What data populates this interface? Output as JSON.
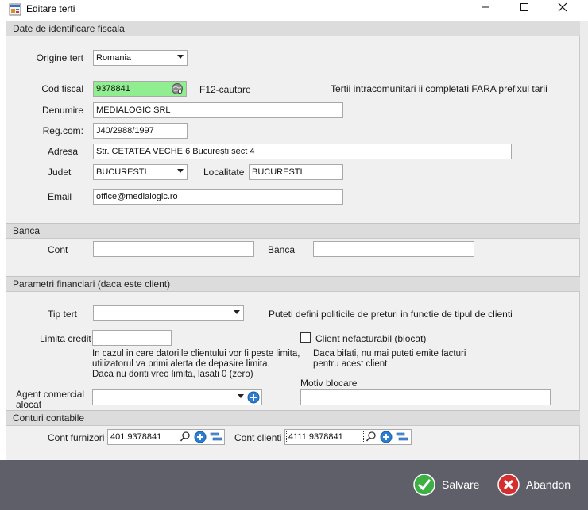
{
  "window": {
    "title": "Editare terti",
    "minimize_icon": "minimize-icon",
    "maximize_icon": "maximize-icon",
    "close_icon": "close-icon"
  },
  "sections": {
    "fiscal": "Date de identificare fiscala",
    "bank": "Banca",
    "financial": "Parametri financiari (daca este client)",
    "accounts": "Conturi contabile"
  },
  "fiscal": {
    "origin_label": "Origine tert",
    "origin_value": "Romania",
    "cod_fiscal_label": "Cod fiscal",
    "cod_fiscal_value": "9378841",
    "f12_hint": "F12-cautare",
    "intracom_note": "Tertii intracomunitari ii completati FARA prefixul tarii",
    "denumire_label": "Denumire",
    "denumire_value": "MEDIALOGIC SRL",
    "regcom_label": "Reg.com:",
    "regcom_value": "J40/2988/1997",
    "adresa_label": "Adresa",
    "adresa_value": "Str. CETATEA VECHE  6  București  sect 4",
    "judet_label": "Judet",
    "judet_value": "BUCURESTI",
    "localitate_label": "Localitate",
    "localitate_value": "BUCURESTI",
    "email_label": "Email",
    "email_value": "office@medialogic.ro"
  },
  "bank": {
    "cont_label": "Cont",
    "cont_value": "",
    "banca_label": "Banca",
    "banca_value": ""
  },
  "financial": {
    "tip_tert_label": "Tip tert",
    "tip_tert_value": "",
    "tip_tert_note": "Puteti defini politicile de preturi in functie de tipul de clienti",
    "limita_label": "Limita credit",
    "limita_value": "",
    "limita_help_1": "In cazul in care datoriile clientului vor fi peste limita,",
    "limita_help_2": "utilizatorul va primi alerta de depasire limita.",
    "limita_help_3": "Daca nu doriti vreo limita, lasati 0 (zero)",
    "nefacturabil_label": "Client nefacturabil (blocat)",
    "nefacturabil_checked": false,
    "nefacturabil_help_1": "Daca bifati, nu mai puteti emite facturi",
    "nefacturabil_help_2": "pentru acest client",
    "agent_label_1": "Agent comercial",
    "agent_label_2": "alocat",
    "agent_value": "",
    "motiv_label": "Motiv blocare",
    "motiv_value": ""
  },
  "accounts": {
    "furnizori_label": "Cont furnizori",
    "furnizori_value": "401.9378841",
    "clienti_label": "Cont clienti",
    "clienti_value": "4111.9378841"
  },
  "footer": {
    "save_label": "Salvare",
    "cancel_label": "Abandon"
  },
  "colors": {
    "cod_fiscal_bg": "#90ee90",
    "footer_bg": "#5f5f6a",
    "section_bg": "#dcdcdc",
    "save_icon": "#3cb043",
    "cancel_icon": "#d32f2f"
  }
}
